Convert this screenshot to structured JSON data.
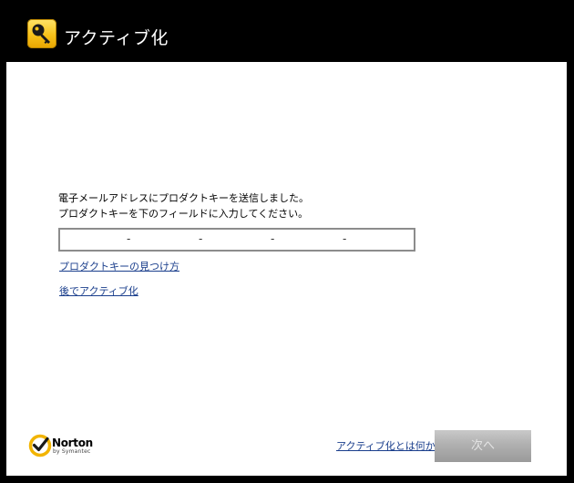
{
  "window": {
    "title": "アクティブ化",
    "icon": "key-icon"
  },
  "main": {
    "instruction_line1": "電子メールアドレスにプロダクトキーを送信しました。",
    "instruction_line2": "プロダクトキーを下のフィールドに入力してください。",
    "product_key": {
      "separator": "-"
    },
    "links": {
      "find_key": "プロダクトキーの見つけ方",
      "activate_later": "後でアクティブ化"
    }
  },
  "footer": {
    "brand_name": "Norton",
    "brand_sub": "by Symantec",
    "what_is_activation_link": "アクティブ化とは何か",
    "next_button_label": "次へ"
  },
  "colors": {
    "titlebar": "#000000",
    "content_background": "#ffffff",
    "link": "#1a3e8c",
    "icon_yellow": "#f7c21a",
    "button_disabled": "#b0b0b0"
  }
}
